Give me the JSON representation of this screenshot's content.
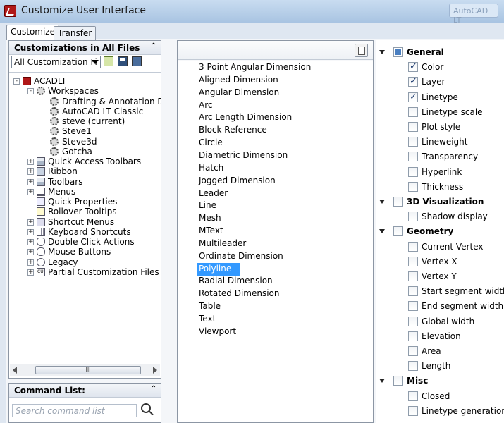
{
  "window": {
    "title": "Customize User Interface",
    "ghost_title": "AutoCAD LT"
  },
  "tabs": [
    {
      "label": "Customize",
      "active": true
    },
    {
      "label": "Transfer",
      "active": false
    }
  ],
  "left_panel": {
    "header": "Customizations in All Files",
    "file_select": "All Customization Fi",
    "tree": [
      {
        "label": "ACADLT",
        "indent": 0,
        "icon": "app-icon",
        "expander": "-"
      },
      {
        "label": "Workspaces",
        "indent": 1,
        "icon": "gear-icon",
        "expander": "-"
      },
      {
        "label": "Drafting & Annotation Defa",
        "indent": 2,
        "icon": "gear-icon",
        "expander": ""
      },
      {
        "label": "AutoCAD LT Classic",
        "indent": 2,
        "icon": "gear-icon",
        "expander": ""
      },
      {
        "label": "steve (current)",
        "indent": 2,
        "icon": "gear-icon",
        "expander": ""
      },
      {
        "label": "Steve1",
        "indent": 2,
        "icon": "gear-icon",
        "expander": ""
      },
      {
        "label": "Steve3d",
        "indent": 2,
        "icon": "gear-icon",
        "expander": ""
      },
      {
        "label": "Gotcha",
        "indent": 2,
        "icon": "gear-icon",
        "expander": ""
      },
      {
        "label": "Quick Access Toolbars",
        "indent": 1,
        "icon": "toolbar-icon",
        "expander": "+"
      },
      {
        "label": "Ribbon",
        "indent": 1,
        "icon": "ribbon-icon",
        "expander": "+"
      },
      {
        "label": "Toolbars",
        "indent": 1,
        "icon": "toolbar-icon",
        "expander": "+"
      },
      {
        "label": "Menus",
        "indent": 1,
        "icon": "menu-icon",
        "expander": "+"
      },
      {
        "label": "Quick Properties",
        "indent": 1,
        "icon": "properties-icon",
        "expander": ""
      },
      {
        "label": "Rollover Tooltips",
        "indent": 1,
        "icon": "tooltip-icon",
        "expander": ""
      },
      {
        "label": "Shortcut Menus",
        "indent": 1,
        "icon": "shortcut-menu-icon",
        "expander": "+"
      },
      {
        "label": "Keyboard Shortcuts",
        "indent": 1,
        "icon": "keyboard-icon",
        "expander": "+"
      },
      {
        "label": "Double Click Actions",
        "indent": 1,
        "icon": "double-click-icon",
        "expander": "+"
      },
      {
        "label": "Mouse Buttons",
        "indent": 1,
        "icon": "mouse-icon",
        "expander": "+"
      },
      {
        "label": "Legacy",
        "indent": 1,
        "icon": "legacy-icon",
        "expander": "+"
      },
      {
        "label": "Partial Customization Files",
        "indent": 1,
        "icon": "cui-file-icon",
        "expander": "+"
      }
    ],
    "scroll_thumb_label": "III"
  },
  "command_list": {
    "header": "Command List:",
    "search_placeholder": "Search command list"
  },
  "command_items": [
    "3 Point Angular Dimension",
    "Aligned Dimension",
    "Angular Dimension",
    "Arc",
    "Arc Length Dimension",
    "Block Reference",
    "Circle",
    "Diametric Dimension",
    "Hatch",
    "Jogged Dimension",
    "Leader",
    "Line",
    "Mesh",
    "MText",
    "Multileader",
    "Ordinate Dimension",
    "Polyline",
    "Radial Dimension",
    "Rotated Dimension",
    "Table",
    "Text",
    "Viewport"
  ],
  "selected_command": "Polyline",
  "property_groups": [
    {
      "name": "General",
      "checked": "blue",
      "items": [
        {
          "label": "Color",
          "checked": true
        },
        {
          "label": "Layer",
          "checked": true
        },
        {
          "label": "Linetype",
          "checked": true
        },
        {
          "label": "Linetype scale",
          "checked": false
        },
        {
          "label": "Plot style",
          "checked": false
        },
        {
          "label": "Lineweight",
          "checked": false
        },
        {
          "label": "Transparency",
          "checked": false
        },
        {
          "label": "Hyperlink",
          "checked": false
        },
        {
          "label": "Thickness",
          "checked": false
        }
      ]
    },
    {
      "name": "3D Visualization",
      "checked": "none",
      "items": [
        {
          "label": "Shadow display",
          "checked": false
        }
      ]
    },
    {
      "name": "Geometry",
      "checked": "none",
      "items": [
        {
          "label": "Current Vertex",
          "checked": false
        },
        {
          "label": "Vertex X",
          "checked": false
        },
        {
          "label": "Vertex Y",
          "checked": false
        },
        {
          "label": "Start segment width",
          "checked": false
        },
        {
          "label": "End segment width",
          "checked": false
        },
        {
          "label": "Global width",
          "checked": false
        },
        {
          "label": "Elevation",
          "checked": false
        },
        {
          "label": "Area",
          "checked": false
        },
        {
          "label": "Length",
          "checked": false
        }
      ]
    },
    {
      "name": "Misc",
      "checked": "none",
      "items": [
        {
          "label": "Closed",
          "checked": false
        },
        {
          "label": "Linetype generation",
          "checked": false
        }
      ]
    }
  ]
}
